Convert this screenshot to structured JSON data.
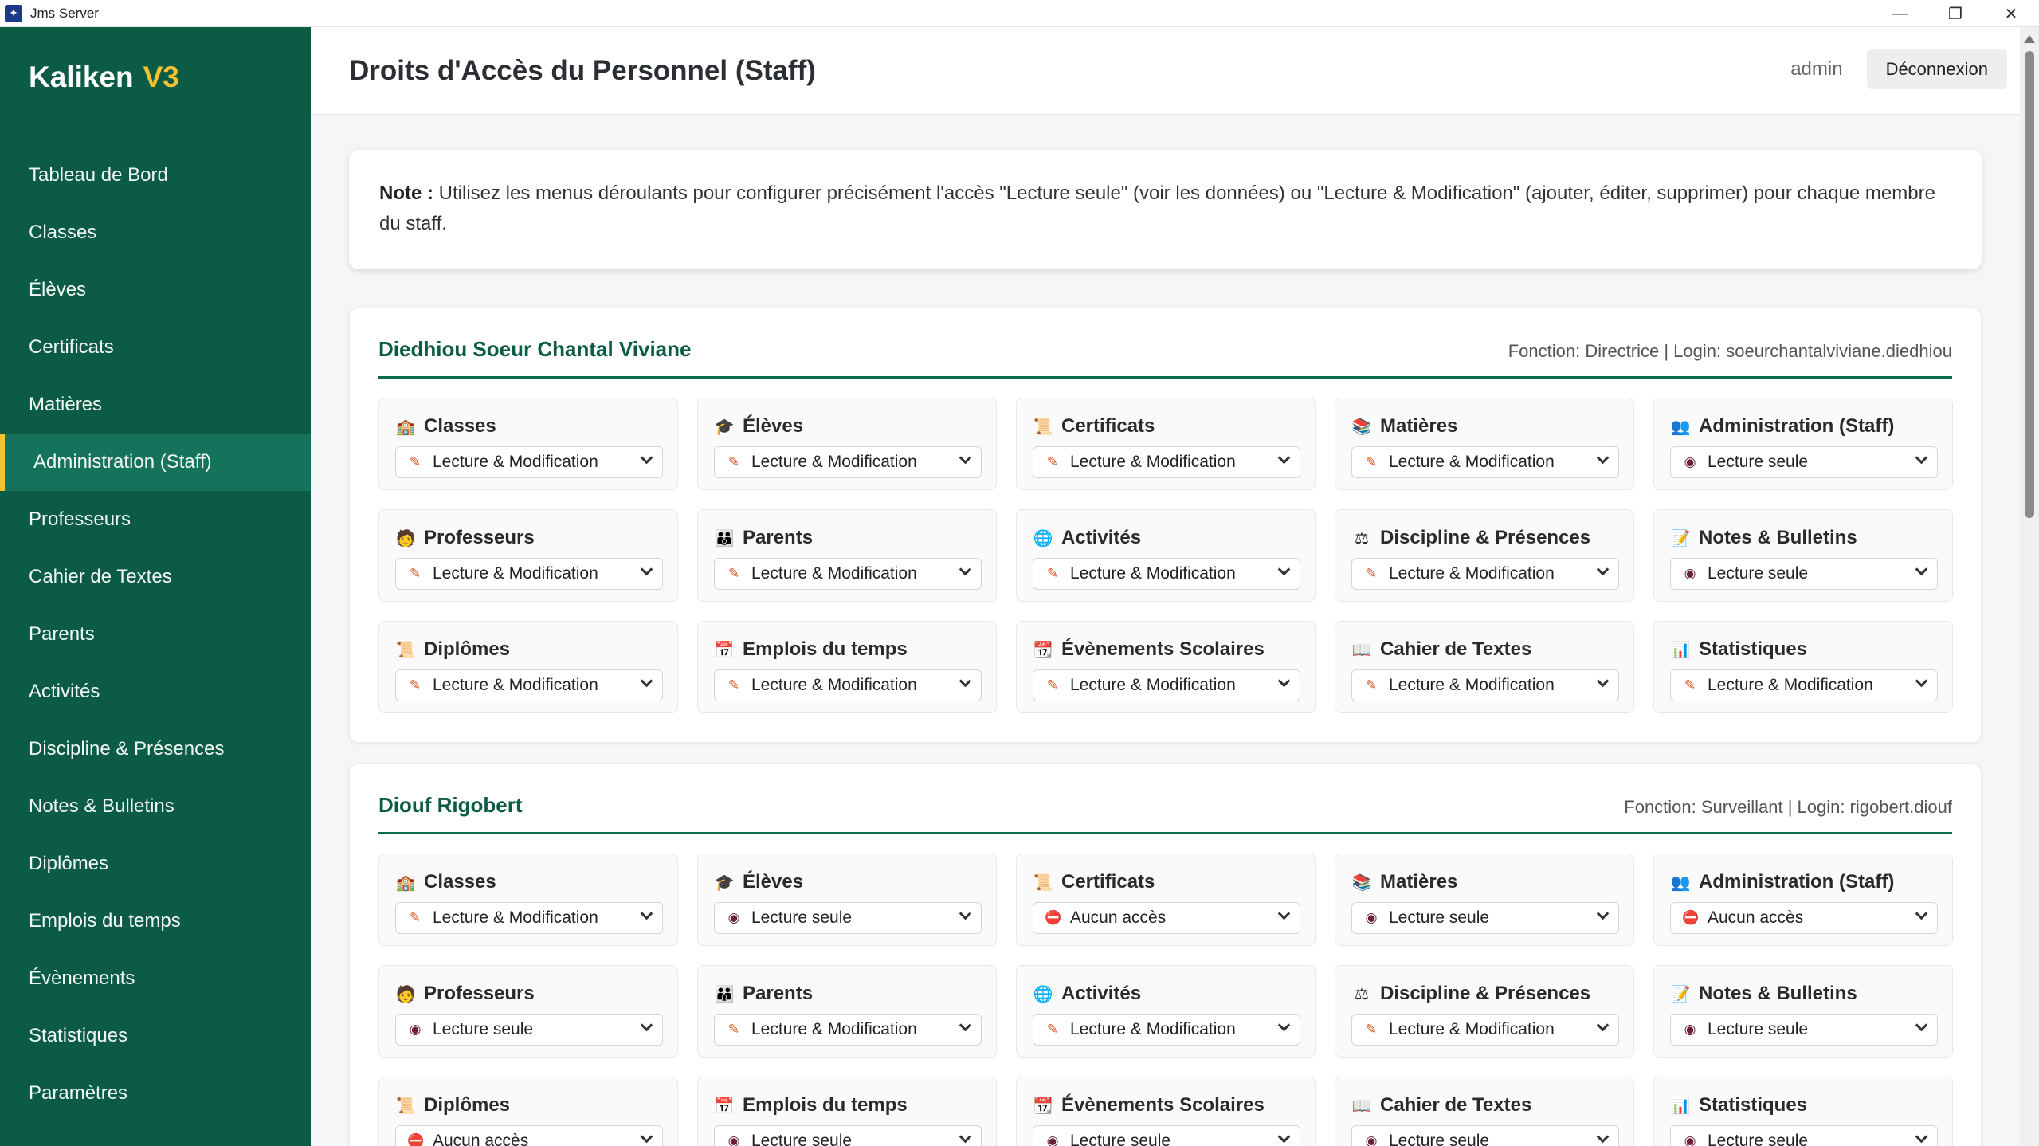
{
  "window": {
    "title": "Jms Server",
    "controls": [
      "—",
      "❐",
      "✕"
    ]
  },
  "brand": {
    "name": "Kaliken",
    "version": "V3"
  },
  "sidebar": {
    "items": [
      {
        "label": "Tableau de Bord",
        "active": false
      },
      {
        "label": "Classes",
        "active": false
      },
      {
        "label": "Élèves",
        "active": false
      },
      {
        "label": "Certificats",
        "active": false
      },
      {
        "label": "Matières",
        "active": false
      },
      {
        "label": "Administration (Staff)",
        "active": true
      },
      {
        "label": "Professeurs",
        "active": false
      },
      {
        "label": "Cahier de Textes",
        "active": false
      },
      {
        "label": "Parents",
        "active": false
      },
      {
        "label": "Activités",
        "active": false
      },
      {
        "label": "Discipline & Présences",
        "active": false
      },
      {
        "label": "Notes & Bulletins",
        "active": false
      },
      {
        "label": "Diplômes",
        "active": false
      },
      {
        "label": "Emplois du temps",
        "active": false
      },
      {
        "label": "Évènements",
        "active": false
      },
      {
        "label": "Statistiques",
        "active": false
      },
      {
        "label": "Paramètres",
        "active": false
      }
    ]
  },
  "header": {
    "title": "Droits d'Accès du Personnel (Staff)",
    "user": "admin",
    "logout_label": "Déconnexion"
  },
  "note": {
    "label": "Note :",
    "text": "Utilisez les menus déroulants pour configurer précisément l'accès \"Lecture seule\" (voir les données) ou \"Lecture & Modification\" (ajouter, éditer, supprimer) pour chaque membre du staff."
  },
  "levels": {
    "edit": {
      "label": "Lecture & Modification",
      "icon": "pencil-icon",
      "glyph": "✎"
    },
    "read": {
      "label": "Lecture seule",
      "icon": "eye-icon",
      "glyph": "◉"
    },
    "none": {
      "label": "Aucun accès",
      "icon": "no-entry-icon",
      "glyph": "⛔"
    }
  },
  "modules": [
    {
      "label": "Classes",
      "icon": "school-icon",
      "glyph": "🏫"
    },
    {
      "label": "Élèves",
      "icon": "graduation-cap-icon",
      "glyph": "🎓"
    },
    {
      "label": "Certificats",
      "icon": "scroll-icon",
      "glyph": "📜"
    },
    {
      "label": "Matières",
      "icon": "books-icon",
      "glyph": "📚"
    },
    {
      "label": "Administration (Staff)",
      "icon": "people-icon",
      "glyph": "👥"
    },
    {
      "label": "Professeurs",
      "icon": "teacher-icon",
      "glyph": "🧑"
    },
    {
      "label": "Parents",
      "icon": "family-icon",
      "glyph": "👪"
    },
    {
      "label": "Activités",
      "icon": "globe-icon",
      "glyph": "🌐"
    },
    {
      "label": "Discipline & Présences",
      "icon": "scales-icon",
      "glyph": "⚖"
    },
    {
      "label": "Notes & Bulletins",
      "icon": "memo-icon",
      "glyph": "📝"
    },
    {
      "label": "Diplômes",
      "icon": "diploma-icon",
      "glyph": "📜"
    },
    {
      "label": "Emplois du temps",
      "icon": "calendar-icon",
      "glyph": "📅"
    },
    {
      "label": "Évènements Scolaires",
      "icon": "calendar-icon",
      "glyph": "📆"
    },
    {
      "label": "Cahier de Textes",
      "icon": "open-book-icon",
      "glyph": "📖"
    },
    {
      "label": "Statistiques",
      "icon": "bar-chart-icon",
      "glyph": "📊"
    }
  ],
  "staff": [
    {
      "name": "Diedhiou Soeur Chantal Viviane",
      "meta": "Fonction: Directrice | Login: soeurchantalviviane.diedhiou",
      "permissions": [
        "edit",
        "edit",
        "edit",
        "edit",
        "read",
        "edit",
        "edit",
        "edit",
        "edit",
        "read",
        "edit",
        "edit",
        "edit",
        "edit",
        "edit"
      ]
    },
    {
      "name": "Diouf Rigobert",
      "meta": "Fonction: Surveillant | Login: rigobert.diouf",
      "permissions": [
        "edit",
        "read",
        "none",
        "read",
        "none",
        "read",
        "edit",
        "edit",
        "edit",
        "read",
        "none",
        "read",
        "read",
        "read",
        "read"
      ]
    }
  ]
}
